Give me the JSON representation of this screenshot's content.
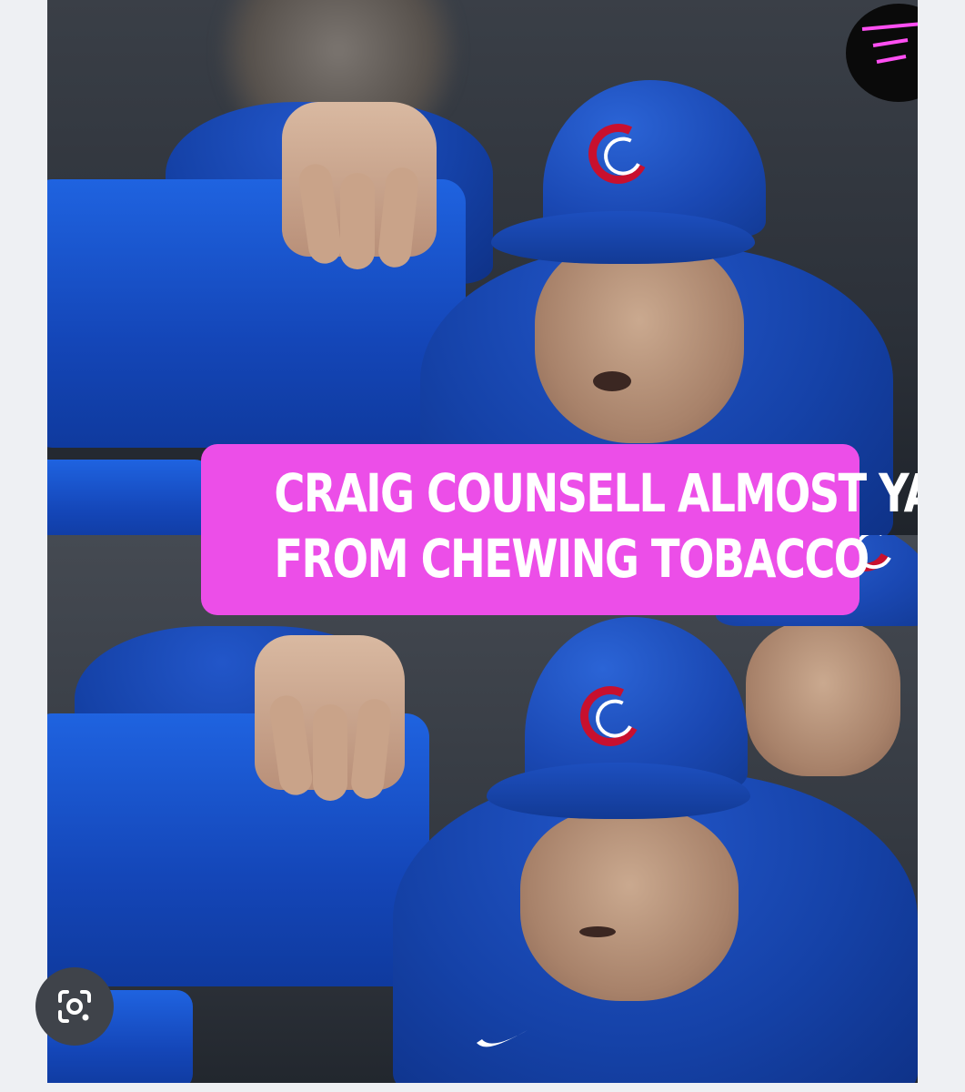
{
  "post_image": {
    "caption": {
      "line1": "CRAIG COUNSELL ALMOST YACKS",
      "line2": "FROM CHEWING TOBACCO"
    },
    "caption_color": "#ec4ee8",
    "team_logo": "cubs-c-logo",
    "watermark_icon": "magenta-ga-mark-icon"
  },
  "overlay": {
    "lens_icon": "google-lens-icon",
    "lens_bg_color": "#3f434a"
  }
}
